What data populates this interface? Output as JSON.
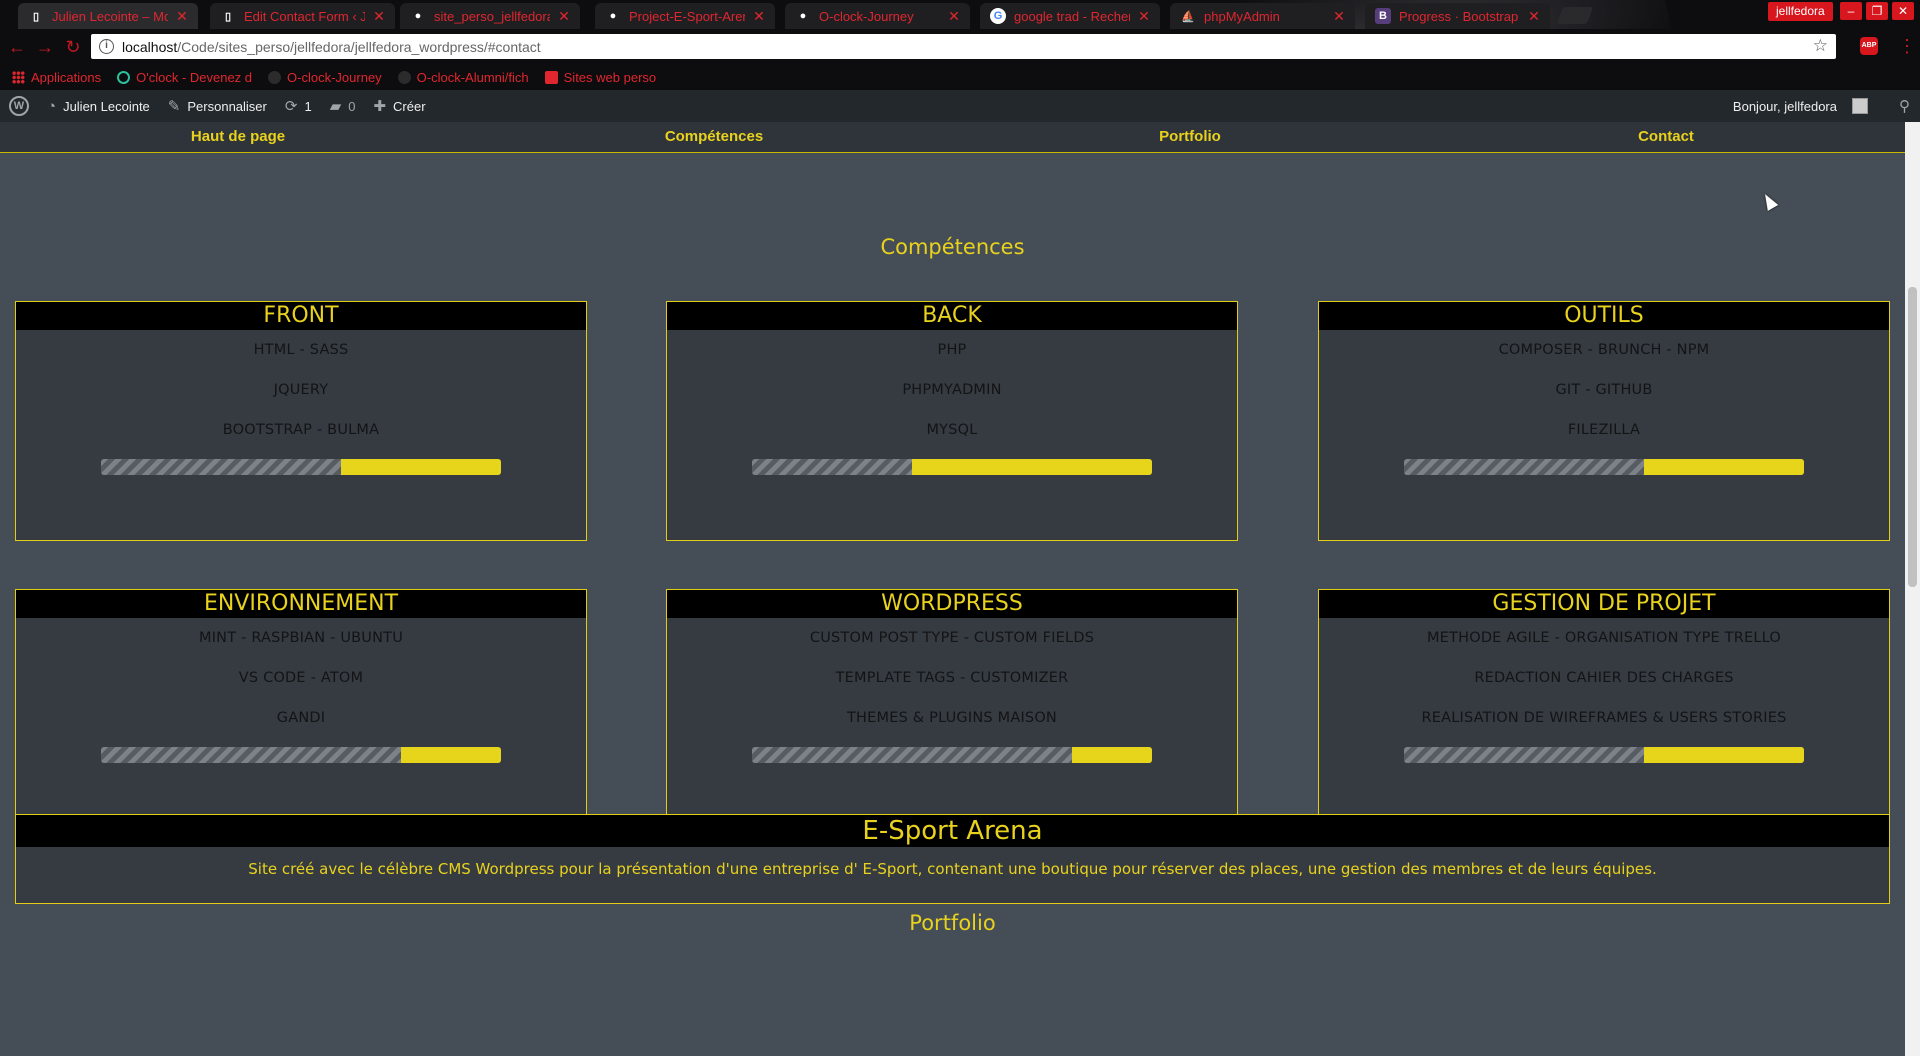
{
  "browser": {
    "tabs": [
      {
        "title": "Julien Lecointe – Mon site",
        "favicon": "page-icon",
        "active": true
      },
      {
        "title": "Edit Contact Form ‹ Juli",
        "favicon": "page-icon",
        "active": false
      },
      {
        "title": "site_perso_jellfedora/jj",
        "favicon": "github-icon",
        "active": false
      },
      {
        "title": "Project-E-Sport-Arena",
        "favicon": "github-icon",
        "active": false
      },
      {
        "title": "O-clock-Journey",
        "favicon": "github-icon",
        "active": false
      },
      {
        "title": "google trad - Recherche",
        "favicon": "google-icon",
        "active": false
      },
      {
        "title": "phpMyAdmin",
        "favicon": "phpmyadmin-icon",
        "active": false
      },
      {
        "title": "Progress · Bootstrap",
        "favicon": "bootstrap-icon",
        "active": false
      }
    ],
    "profile_name": "jellfedora",
    "url_host": "localhost",
    "url_path": "/Code/sites_perso/jellfedora/jellfedora_wordpress/#contact",
    "abp_label": "ABP",
    "bookmarks": [
      {
        "label": "Applications",
        "icon": "apps-icon"
      },
      {
        "label": "O'clock - Devenez d",
        "icon": "oclock-icon"
      },
      {
        "label": "O-clock-Journey",
        "icon": "github-icon"
      },
      {
        "label": "O-clock-Alumni/fich",
        "icon": "github-icon"
      },
      {
        "label": "Sites web perso",
        "icon": "folder-icon"
      }
    ]
  },
  "adminbar": {
    "site_name": "Julien Lecointe",
    "customize": "Personnaliser",
    "updates_count": "1",
    "comments_count": "0",
    "new_label": "Créer",
    "greeting": "Bonjour, jellfedora"
  },
  "nav": {
    "items": [
      "Haut de page",
      "Compétences",
      "Portfolio",
      "Contact"
    ]
  },
  "skills": {
    "title": "Compétences",
    "cards": [
      {
        "name": "FRONT",
        "lines": [
          "HTML - SASS",
          "JQUERY",
          "BOOTSTRAP - BULMA"
        ],
        "level": 0.4
      },
      {
        "name": "BACK",
        "lines": [
          "PHP",
          "PHPMYADMIN",
          "MYSQL"
        ],
        "level": 0.6
      },
      {
        "name": "OUTILS",
        "lines": [
          "COMPOSER - BRUNCH - NPM",
          "GIT - GITHUB",
          "FILEZILLA"
        ],
        "level": 0.4
      },
      {
        "name": "ENVIRONNEMENT",
        "lines": [
          "MINT - RASPBIAN - UBUNTU",
          "VS CODE - ATOM",
          "GANDI"
        ],
        "level": 0.25
      },
      {
        "name": "WORDPRESS",
        "lines": [
          "CUSTOM POST TYPE - CUSTOM FIELDS",
          "TEMPLATE TAGS - CUSTOMIZER",
          "THEMES & PLUGINS MAISON"
        ],
        "level": 0.2
      },
      {
        "name": "GESTION DE PROJET",
        "lines": [
          "METHODE AGILE - ORGANISATION TYPE TRELLO",
          "REDACTION CAHIER DES CHARGES",
          "REALISATION DE WIREFRAMES & USERS STORIES"
        ],
        "level": 0.4
      }
    ]
  },
  "portfolio": {
    "title": "Portfolio",
    "project_name": "E-Sport Arena",
    "project_description": "Site créé avec le célèbre CMS Wordpress pour la présentation d'une entreprise d' E-Sport, contenant une boutique pour réserver des places, une gestion des membres et de leurs équipes."
  },
  "colors": {
    "accent": "#e8d21d",
    "page_bg": "#454d56",
    "card_bg": "#363b42",
    "browser_accent": "#e0262f"
  }
}
